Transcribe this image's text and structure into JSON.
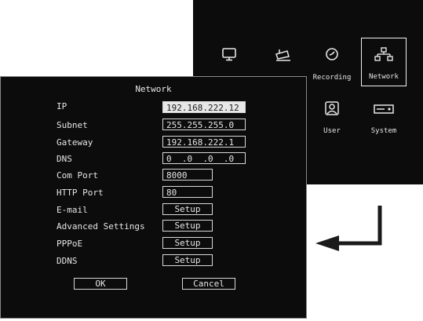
{
  "main_menu": {
    "items": [
      {
        "label": "",
        "icon": "monitor-icon"
      },
      {
        "label": "",
        "icon": "camera-icon"
      },
      {
        "label": "Recording",
        "icon": "clock-icon"
      },
      {
        "label": "Network",
        "icon": "network-icon",
        "selected": true
      },
      {
        "label": "User",
        "icon": "user-icon"
      },
      {
        "label": "System",
        "icon": "hard-drive-icon"
      }
    ]
  },
  "dialog": {
    "title": "Network",
    "fields": [
      {
        "label": "IP",
        "value": "192.168.222.12"
      },
      {
        "label": "Subnet",
        "value": "255.255.255.0"
      },
      {
        "label": "Gateway",
        "value": "192.168.222.1"
      },
      {
        "label": "DNS",
        "value": "0  .0  .0  .0"
      },
      {
        "label": "Com Port",
        "value": "8000"
      },
      {
        "label": "HTTP Port",
        "value": "80"
      }
    ],
    "setup_rows": [
      {
        "label": "E-mail",
        "button": "Setup"
      },
      {
        "label": "Advanced Settings",
        "button": "Setup"
      },
      {
        "label": "PPPoE",
        "button": "Setup"
      },
      {
        "label": "DDNS",
        "button": "Setup"
      }
    ],
    "ok_label": "OK",
    "cancel_label": "Cancel"
  },
  "colors": {
    "background": "#0c0c0c",
    "text": "#e6e6e6",
    "selected_fill": "#e8e8e8",
    "arrow": "#1a1a1a"
  }
}
